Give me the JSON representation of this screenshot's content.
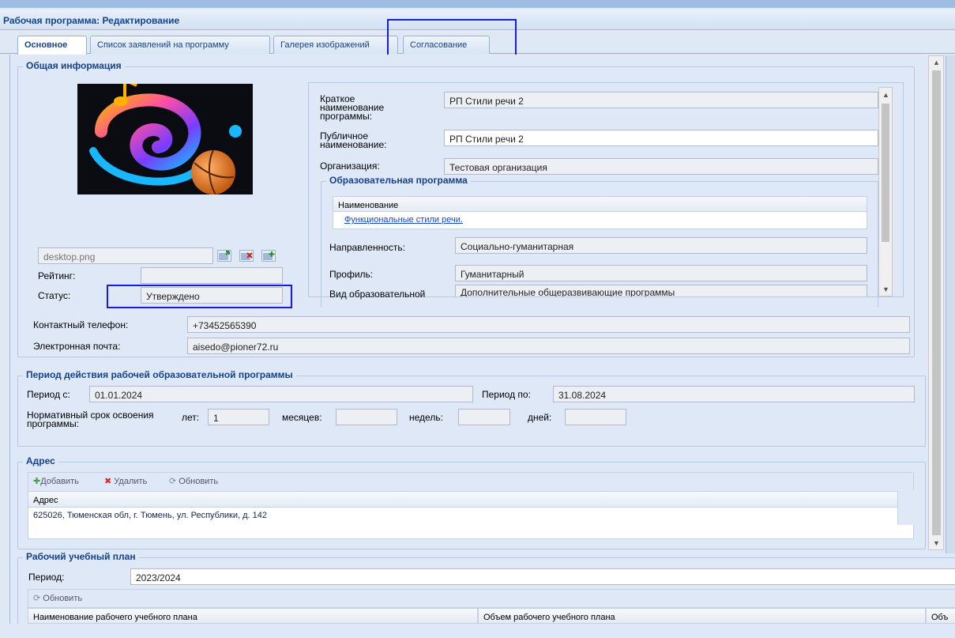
{
  "window": {
    "title": "Рабочая программа: Редактирование"
  },
  "tabs": [
    {
      "label": "Основное"
    },
    {
      "label": "Список заявлений на программу"
    },
    {
      "label": "Галерея изображений"
    },
    {
      "label": "Согласование"
    }
  ],
  "general": {
    "legend": "Общая информация",
    "file_name": "desktop.png",
    "rating_label": "Рейтинг:",
    "rating_value": "",
    "status_label": "Статус:",
    "status_value": "Утверждено",
    "short_name_label": "Краткое наименование программы:",
    "short_name_value": "РП Стили речи 2",
    "public_name_label": "Публичное наименование:",
    "public_name_value": "РП Стили речи 2",
    "org_label": "Организация:",
    "org_value": "Тестовая организация",
    "edu_program": {
      "legend": "Образовательная программа",
      "col_name": "Наименование",
      "row_value": "Функциональные стили речи.",
      "direction_label": "Направленность:",
      "direction_value": "Социально-гуманитарная",
      "profile_label": "Профиль:",
      "profile_value": "Гуманитарный",
      "type_label": "Вид образовательной",
      "type_value": "Дополнительные общеразвивающие программы"
    },
    "phone_label": "Контактный телефон:",
    "phone_value": "+73452565390",
    "email_label": "Электронная почта:",
    "email_value": "aisedo@pioner72.ru"
  },
  "period": {
    "legend": "Период действия рабочей образовательной программы",
    "from_label": "Период с:",
    "from_value": "01.01.2024",
    "to_label": "Период по:",
    "to_value": "31.08.2024",
    "norm_label": "Нормативный срок освоения программы:",
    "years_label": "лет:",
    "years_value": "1",
    "months_label": "месяцев:",
    "months_value": "",
    "weeks_label": "недель:",
    "weeks_value": "",
    "days_label": "дней:",
    "days_value": ""
  },
  "address": {
    "legend": "Адрес",
    "add_label": "Добавить",
    "delete_label": "Удалить",
    "refresh_label": "Обновить",
    "col_label": "Адрес",
    "rows": [
      "625026, Тюменская обл, г. Тюмень, ул. Республики, д. 142"
    ]
  },
  "plan": {
    "legend": "Рабочий учебный план",
    "period_label": "Период:",
    "period_value": "2023/2024",
    "refresh_label": "Обновить",
    "col_name": "Наименование рабочего учебного плана",
    "col_volume": "Объем рабочего учебного плана",
    "col_more": "Объ"
  },
  "colors": {
    "accent": "#15428b",
    "highlight": "#1a1ae6"
  }
}
